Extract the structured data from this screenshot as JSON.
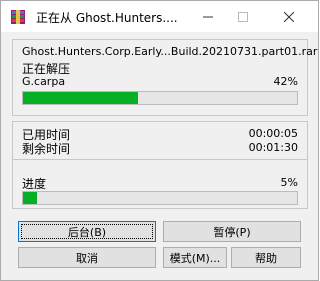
{
  "window": {
    "title": "正在从 Ghost.Hunters...."
  },
  "extract": {
    "filename": "Ghost.Hunters.Corp.Early...Build.20210731.part01.rar",
    "status": "正在解压",
    "current_file": "G.carpa",
    "file_percent_label": "42%",
    "file_progress": 0.42
  },
  "time": {
    "elapsed_label": "已用时间",
    "elapsed_value": "00:00:05",
    "remaining_label": "剩余时间",
    "remaining_value": "00:01:30"
  },
  "overall": {
    "label": "进度",
    "percent_label": "5%",
    "progress": 0.05
  },
  "buttons": {
    "background": "后台(B)",
    "pause": "暂停(P)",
    "cancel": "取消",
    "mode": "模式(M)...",
    "help": "帮助"
  },
  "colors": {
    "progress": "#06b025",
    "default_button_border": "#0078d7"
  },
  "icons": {
    "app": "winrar-icon",
    "minimize": "minimize-icon",
    "maximize": "maximize-icon",
    "close": "close-icon"
  }
}
